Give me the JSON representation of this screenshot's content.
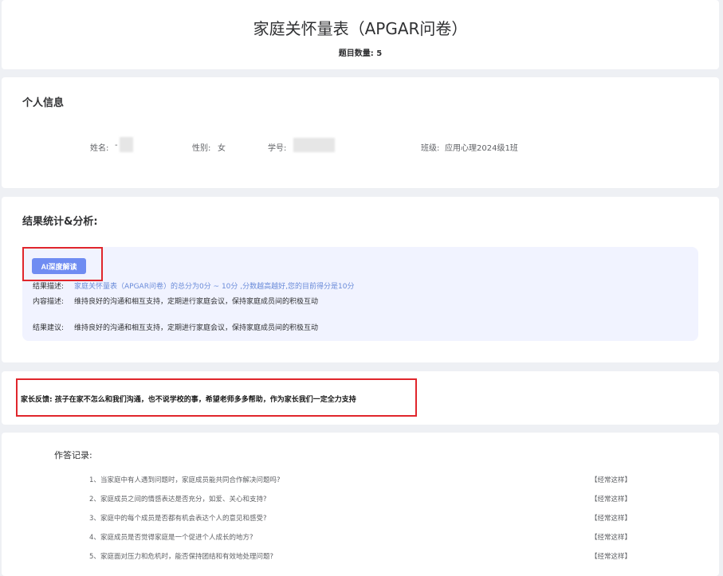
{
  "header": {
    "title": "家庭关怀量表（APGAR问卷）",
    "question_count_label": "题目数量:",
    "question_count": "5"
  },
  "personal": {
    "section_title": "个人信息",
    "name_label": "姓名:",
    "name_value": "-",
    "gender_label": "性别:",
    "gender_value": "女",
    "student_id_label": "学号:",
    "student_id_value": "",
    "class_label": "班级:",
    "class_value": "应用心理2024级1班"
  },
  "result": {
    "section_title": "结果统计&分析:",
    "ai_button_label": "AI深度解读",
    "rows": [
      {
        "label": "结果描述:",
        "value": "家庭关怀量表（APGAR问卷）的总分为0分 ~ 10分 ,分数越高越好,您的目前得分是10分"
      },
      {
        "label": "内容描述:",
        "value": "维持良好的沟通和相互支持，定期进行家庭会议，保持家庭成员间的积极互动"
      },
      {
        "label": "结果建议:",
        "value": "维持良好的沟通和相互支持，定期进行家庭会议，保持家庭成员间的积极互动"
      }
    ]
  },
  "feedback": {
    "text": "家长反馈: 孩子在家不怎么和我们沟通，也不说学校的事，希望老师多多帮助，作为家长我们一定全力支持"
  },
  "records": {
    "title": "作答记录:",
    "items": [
      {
        "num": "1、",
        "question": "当家庭中有人遇到问题时，家庭成员能共同合作解决问题吗?",
        "answer": "【经常这样】"
      },
      {
        "num": "2、",
        "question": "家庭成员之间的情感表达是否充分，如爱、关心和支持?",
        "answer": "【经常这样】"
      },
      {
        "num": "3、",
        "question": "家庭中的每个成员是否都有机会表达个人的意见和感受?",
        "answer": "【经常这样】"
      },
      {
        "num": "4、",
        "question": "家庭成员是否觉得家庭是一个促进个人成长的地方?",
        "answer": "【经常这样】"
      },
      {
        "num": "5、",
        "question": "家庭面对压力和危机时，能否保持团结和有效地处理问题?",
        "answer": "【经常这样】"
      }
    ]
  },
  "colors": {
    "accent": "#6f8cf2",
    "highlight_border": "#e0262c",
    "analysis_bg": "#f1f3ff",
    "page_bg": "#eef0f4"
  }
}
